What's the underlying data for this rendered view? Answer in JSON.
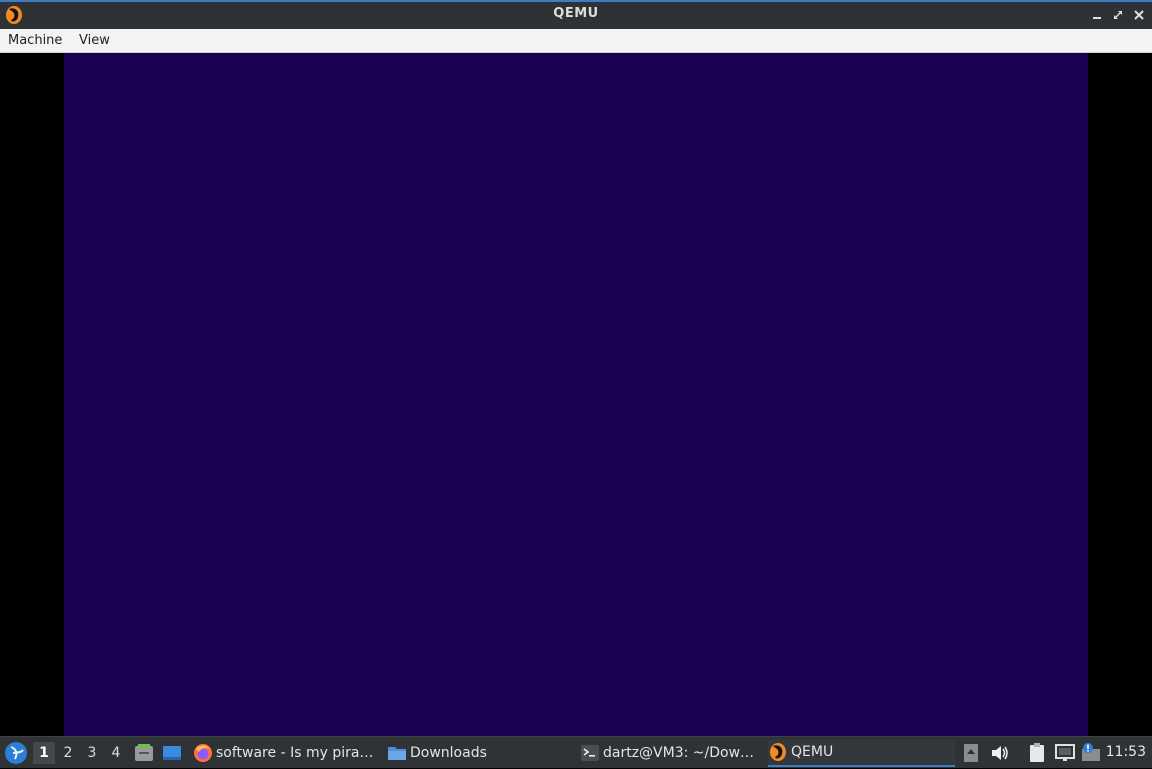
{
  "window": {
    "title": "QEMU",
    "app_icon": "qemu-icon"
  },
  "menubar": {
    "items": [
      {
        "label": "Machine"
      },
      {
        "label": "View"
      }
    ]
  },
  "guest_display": {
    "background": "#1b0153"
  },
  "taskbar": {
    "start_icon": "lxqt-start-icon",
    "desktops": [
      {
        "label": "1",
        "active": true
      },
      {
        "label": "2",
        "active": false
      },
      {
        "label": "3",
        "active": false
      },
      {
        "label": "4",
        "active": false
      }
    ],
    "launchers": [
      "file-manager-icon",
      "show-desktop-icon"
    ],
    "tasks": [
      {
        "label": "software - Is my pira…",
        "icon": "firefox-icon"
      },
      {
        "label": "Downloads",
        "icon": "folder-icon"
      },
      {
        "label": "dartz@VM3: ~/Dow…",
        "icon": "terminal-icon"
      },
      {
        "label": "QEMU",
        "icon": "qemu-icon",
        "active": true
      }
    ],
    "tray": [
      "tray-expand-icon",
      "volume-icon",
      "clipboard-icon",
      "network-icon",
      "notification-icon"
    ],
    "clock": "11:53"
  },
  "colors": {
    "accent": "#3e7bc5",
    "titlebar": "#2f3235",
    "taskbar": "#2f3336"
  }
}
